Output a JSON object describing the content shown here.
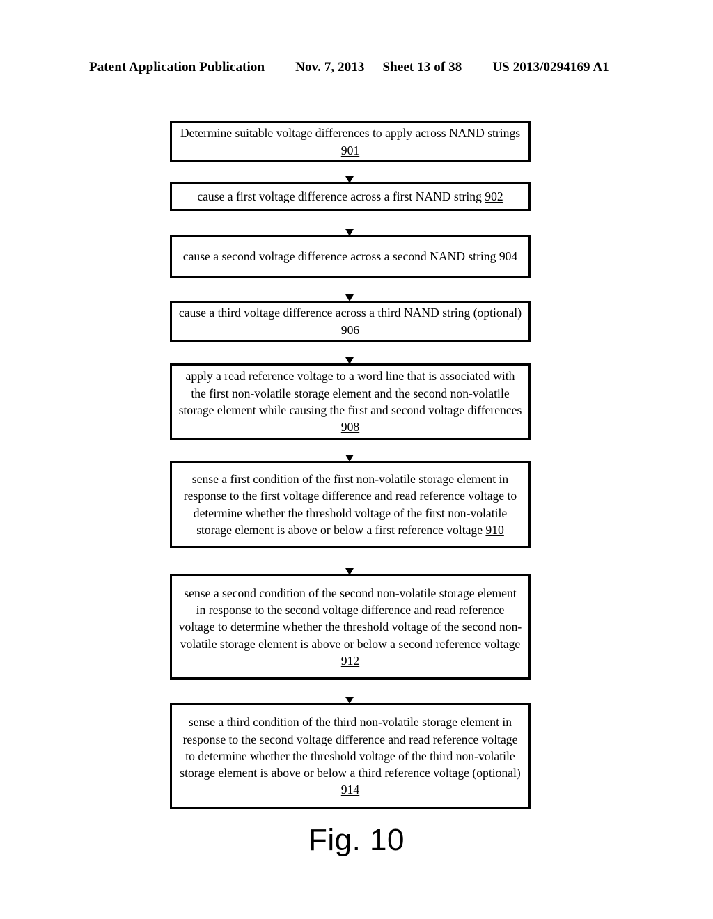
{
  "header": {
    "publication": "Patent Application Publication",
    "date": "Nov. 7, 2013",
    "sheet": "Sheet 13 of 38",
    "document_number": "US 2013/0294169 A1"
  },
  "figure": {
    "caption": "Fig. 10",
    "type": "flowchart",
    "nodes": [
      {
        "id": "901",
        "text": "Determine suitable voltage differences to apply across NAND strings ",
        "ref": "901"
      },
      {
        "id": "902",
        "text": "cause a first voltage difference across a first NAND string ",
        "ref": "902"
      },
      {
        "id": "904",
        "text": "cause a second voltage difference across a second NAND string ",
        "ref": "904"
      },
      {
        "id": "906",
        "text": "cause a third voltage difference across a third NAND string (optional) ",
        "ref": "906"
      },
      {
        "id": "908",
        "text": "apply a read reference voltage to a word line that is associated with the first non-volatile storage element and the second non-volatile storage element while causing the first and second voltage differences ",
        "ref": "908"
      },
      {
        "id": "910",
        "text": "sense a first condition of the first non-volatile storage element in response to the first voltage difference and read reference voltage to determine whether the threshold voltage of the first non-volatile storage element is above or below a first reference voltage  ",
        "ref": "910"
      },
      {
        "id": "912",
        "text": "sense a second condition of the second non-volatile storage element in response to the second voltage difference and read reference voltage to determine whether the threshold voltage of the second non-volatile storage element is above or below a second reference voltage ",
        "ref": "912"
      },
      {
        "id": "914",
        "text": "sense a third condition of the third non-volatile storage element in response to the second voltage difference and read reference voltage to determine whether the threshold voltage of the third non-volatile storage element is above or below a third reference voltage (optional) ",
        "ref": "914"
      }
    ],
    "connectors": [
      {
        "from": "901",
        "to": "902"
      },
      {
        "from": "902",
        "to": "904"
      },
      {
        "from": "904",
        "to": "906"
      },
      {
        "from": "906",
        "to": "908"
      },
      {
        "from": "908",
        "to": "910"
      },
      {
        "from": "910",
        "to": "912"
      },
      {
        "from": "912",
        "to": "914"
      }
    ]
  },
  "colors": {
    "ink": "#000000",
    "paper": "#ffffff",
    "connector": "#555555"
  }
}
